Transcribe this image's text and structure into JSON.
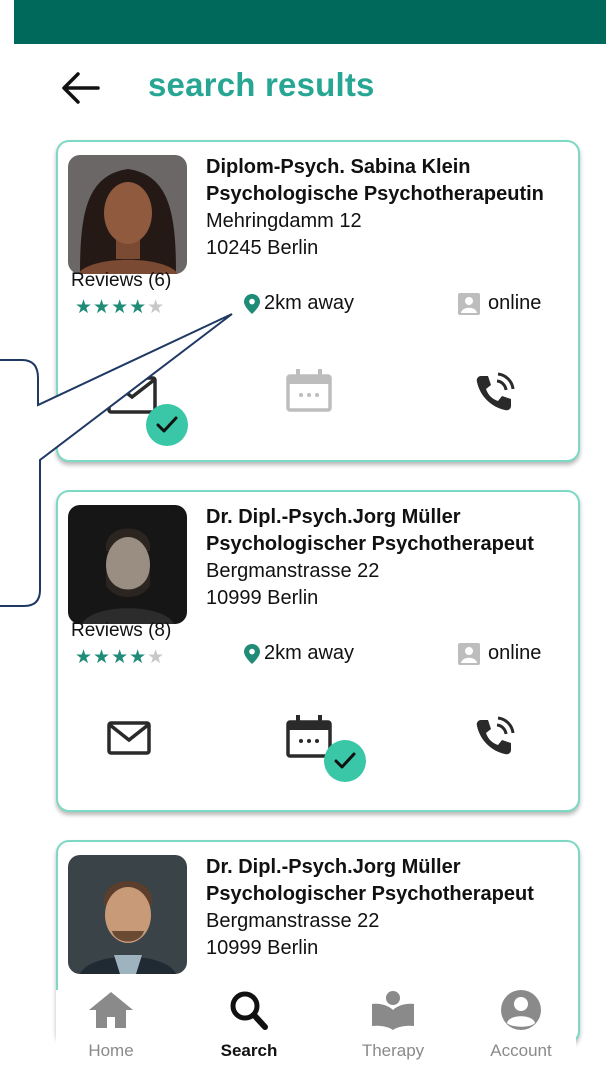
{
  "header": {
    "title": "search results"
  },
  "cards": [
    {
      "line1": "Diplom-Psych. Sabina Klein",
      "line2": "Psychologische Psychotherapeutin",
      "street": "Mehringdamm 12",
      "city": "10245 Berlin",
      "reviews": "Reviews (6)",
      "rating": 4,
      "distance": "2km away",
      "online": "online",
      "checked_action": "message"
    },
    {
      "line1": "Dr. Dipl.-Psych.Jorg Müller",
      "line2": "Psychologischer Psychotherapeut",
      "street": "Bergmanstrasse 22",
      "city": "10999 Berlin",
      "reviews": "Reviews (8)",
      "rating": 4,
      "distance": "2km away",
      "online": "online",
      "checked_action": "calendar"
    },
    {
      "line1": "Dr. Dipl.-Psych.Jorg Müller",
      "line2": "Psychologischer Psychotherapeut",
      "street": "Bergmanstrasse 22",
      "city": "10999 Berlin"
    }
  ],
  "nav": {
    "home": "Home",
    "search": "Search",
    "therapy": "Therapy",
    "account": "Account",
    "active": "search"
  },
  "colors": {
    "header_bar": "#00695c",
    "title": "#26a693",
    "card_border": "#7ed9c4",
    "check": "#39c7a8",
    "callout_stroke": "#1f3864"
  }
}
